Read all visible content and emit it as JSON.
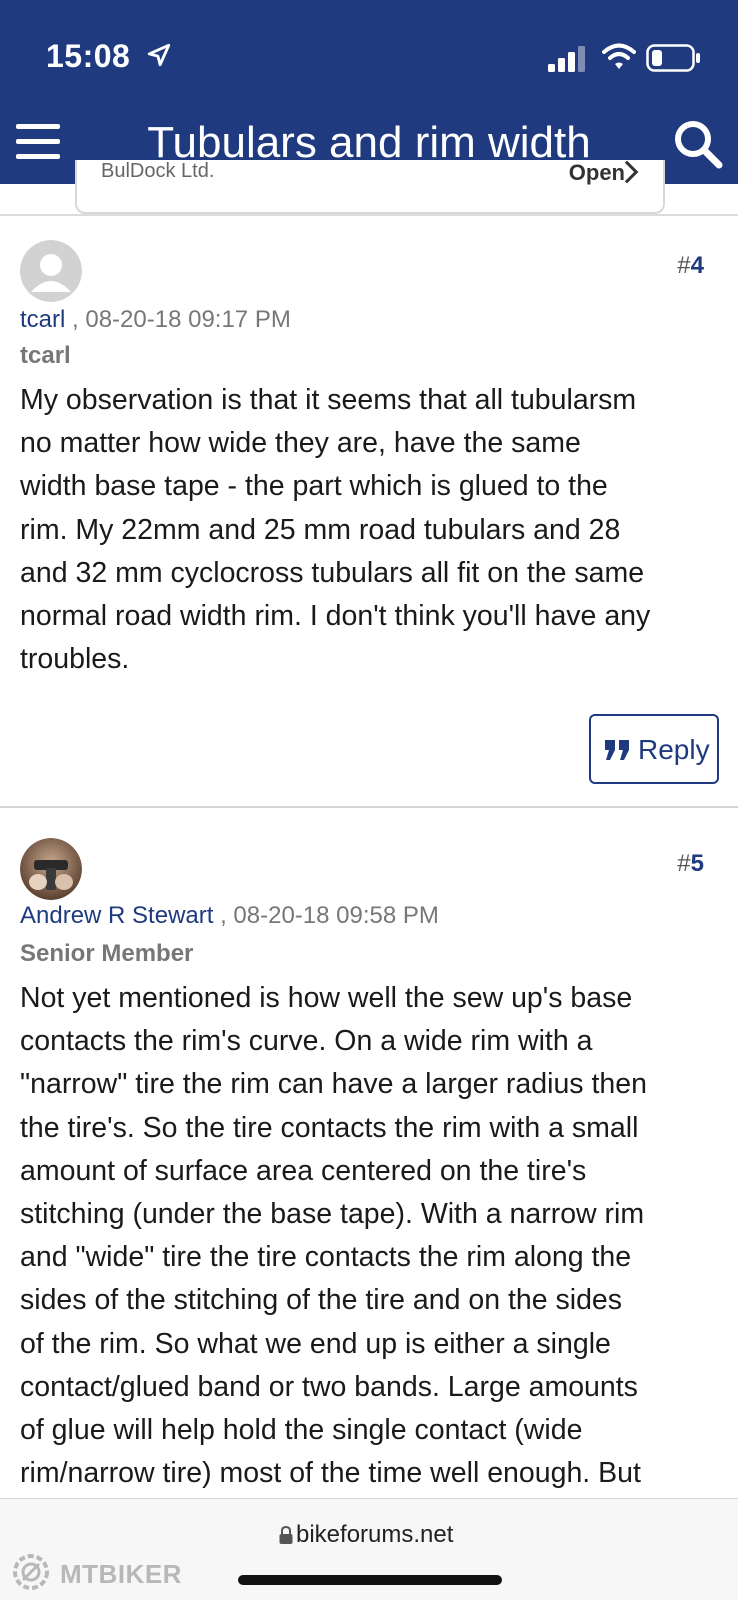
{
  "status_bar": {
    "time": "15:08",
    "icons": [
      "location-arrow-icon",
      "signal-icon",
      "wifi-icon",
      "battery-icon"
    ]
  },
  "nav": {
    "title": "Tubulars and rim width",
    "icons": [
      "menu-icon",
      "search-icon"
    ],
    "color": "#1f3a7e"
  },
  "ad": {
    "left_text": "BulDock Ltd.",
    "right_text": "Open"
  },
  "posts": [
    {
      "number_prefix": "#",
      "number": "4",
      "username": "tcarl",
      "separator": " , ",
      "datetime": "08-20-18 09:17 PM",
      "rank": "tcarl",
      "avatar": "default-avatar-icon",
      "body_lines": [
        "My observation is that it seems that all tubularsm",
        "no matter how wide they are, have the same",
        "width base tape - the part which is glued to the",
        "rim. My 22mm and 25 mm road tubulars and 28",
        "and 32 mm cyclocross tubulars all fit on the same",
        "normal road width rim. I don't think you'll have any",
        "troubles."
      ],
      "reply_label": "Reply"
    },
    {
      "number_prefix": "#",
      "number": "5",
      "username": "Andrew R Stewart",
      "separator": " , ",
      "datetime": "08-20-18 09:58 PM",
      "rank": "Senior Member",
      "avatar": "user-photo-avatar",
      "body_lines": [
        "Not yet mentioned is how well the sew up's base",
        "contacts the rim's curve. On a wide rim with a",
        "\"narrow\" tire the rim can have a larger radius then",
        "the tire's. So the tire contacts the rim with a small",
        "amount of surface area centered on the tire's",
        "stitching (under the base tape). With a narrow rim",
        "and \"wide\" tire the tire contacts the rim along the",
        "sides of the stitching of the tire and on the sides",
        "of the rim. So what we end up is either a single",
        "contact/glued band or two bands. Large amounts",
        "of glue will help hold the single contact (wide",
        "rim/narrow tire) most of the time well enough. But"
      ]
    }
  ],
  "footer": {
    "domain": "bikeforums.net",
    "watermark": "MTBIKER"
  }
}
